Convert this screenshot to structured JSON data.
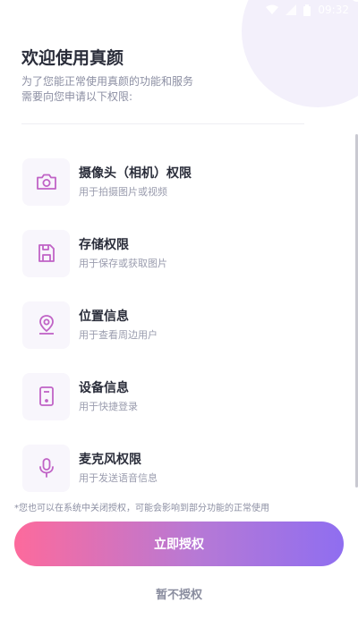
{
  "status_bar": {
    "time": "09:32"
  },
  "header": {
    "title": "欢迎使用真颜",
    "subtitle_line1": "为了您能正常使用真颜的功能和服务",
    "subtitle_line2": "需要向您申请以下权限:"
  },
  "permissions": [
    {
      "icon": "camera-icon",
      "title": "摄像头（相机）权限",
      "desc": "用于拍摄图片或视频"
    },
    {
      "icon": "storage-icon",
      "title": "存储权限",
      "desc": "用于保存或获取图片"
    },
    {
      "icon": "location-icon",
      "title": "位置信息",
      "desc": "用于查看周边用户"
    },
    {
      "icon": "device-icon",
      "title": "设备信息",
      "desc": "用于快捷登录"
    },
    {
      "icon": "microphone-icon",
      "title": "麦克风权限",
      "desc": "用于发送语音信息"
    }
  ],
  "footer": {
    "note": "*您也可以在系统中关闭授权，可能会影响到部分功能的正常使用",
    "grant_label": "立即授权",
    "decline_label": "暂不授权"
  },
  "colors": {
    "accent_icon": "#c063c6",
    "gradient_start": "#fd6a9c",
    "gradient_end": "#8f6ef0"
  }
}
